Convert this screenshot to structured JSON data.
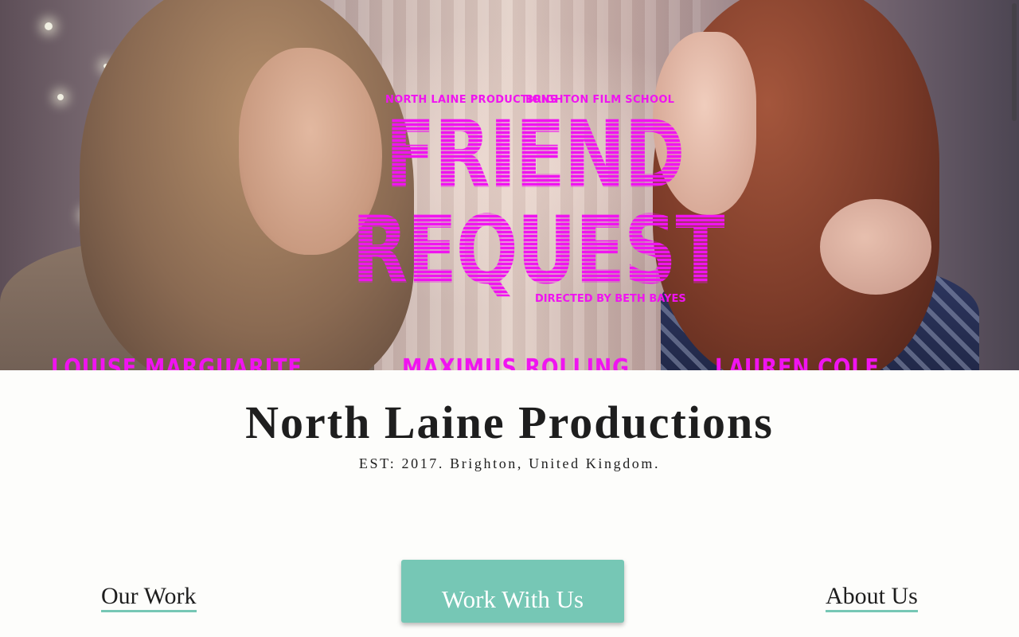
{
  "hero": {
    "credit_a": "NORTH LAINE PRODUCTIONS",
    "credit_b": "BRIGHTON FILM SCHOOL",
    "title_line1": "FRIEND",
    "title_line2": "REQUEST",
    "director": "DIRECTED BY BETH BAYES",
    "cast": [
      "LOUISE MARGUARITE",
      "MAXIMUS ROLLING",
      "LAUREN COLE"
    ],
    "accent_color": "#f014f0"
  },
  "brand": {
    "title": "North Laine Productions",
    "subtitle": "EST: 2017. Brighton, United Kingdom."
  },
  "nav": {
    "left_label": "Our Work",
    "cta_label": "Work With Us",
    "right_label": "About Us",
    "accent_color": "#76c7b5"
  }
}
